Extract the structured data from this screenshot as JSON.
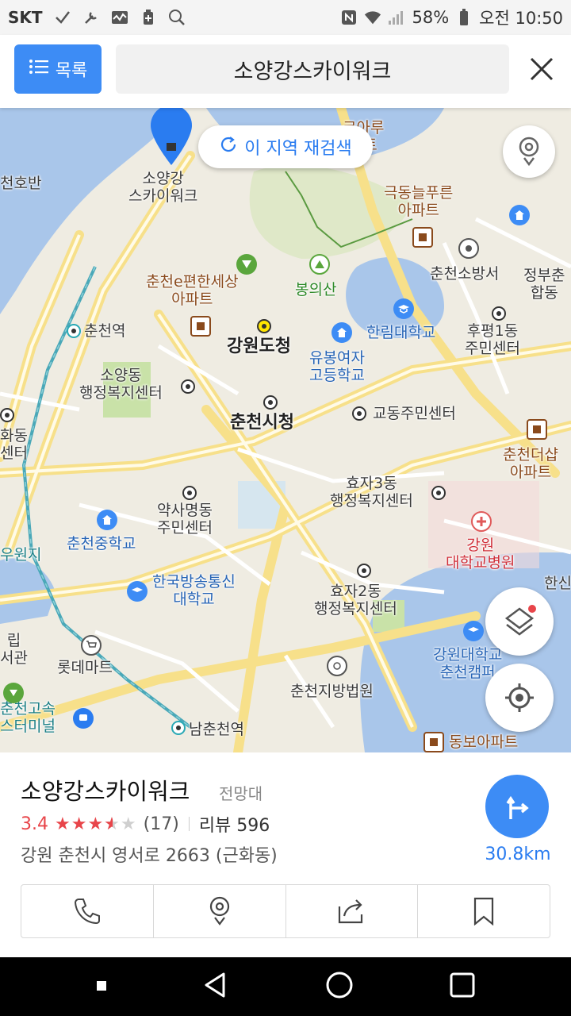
{
  "status": {
    "carrier": "SKT",
    "battery": "58%",
    "time": "오전 10:50"
  },
  "header": {
    "list_label": "목록",
    "search_value": "소양강스카이워크"
  },
  "map": {
    "research_label": "이 지역 재검색",
    "labels": {
      "hoban": "천호반",
      "skywalk_pin": "소양강\n스카이워크",
      "apt1": "코아루\n파트",
      "geukdong": "극동늘푸른\n아파트",
      "chuncheon_e": "춘천e편한세상\n아파트",
      "bongui": "봉의산",
      "chuncheon_st": "춘천역",
      "gangwon_office": "강원도청",
      "hallym": "한림대학교",
      "fire": "춘천소방서",
      "gov": "정부춘\n합동",
      "hupyeong": "후평1동\n주민센터",
      "soyang_center": "소양동\n행정복지센터",
      "yubong": "유봉여자\n고등학교",
      "city_hall": "춘천시청",
      "gyodong": "교동주민센터",
      "hwadong": "화동\n센터",
      "chunchundeo": "춘천더샵\n아파트",
      "hyoja3": "효자3동\n행정복지센터",
      "yaksa": "약사명동\n주민센터",
      "chuncheon_ms": "춘천중학교",
      "uwon": "우원지",
      "gangwon_hosp": "강원\n대학교병원",
      "knou": "한국방송통신\n대학교",
      "hyoja2": "효자2동\n행정복지센터",
      "hansin": "한신",
      "library": "립\n서관",
      "lotte": "롯데마트",
      "kangwon_univ": "강원대학교\n춘천캠퍼",
      "court": "춘천지방법원",
      "bus_terminal": "춘천고속\n스터미널",
      "namchuncheon": "남춘천역",
      "dongbo": "동보아파트"
    }
  },
  "place": {
    "name": "소양강스카이워크",
    "category": "전망대",
    "rating": "3.4",
    "rating_value": 3.4,
    "review_count_paren": "(17)",
    "review_label": "리뷰 596",
    "address": "강원 춘천시 영서로 2663 (근화동)",
    "distance": "30.8km"
  },
  "colors": {
    "accent": "#3d8cf5",
    "rating": "#e8454a",
    "water": "#a9c6ea",
    "road": "#f7e08a",
    "park": "#c9e2a8"
  }
}
